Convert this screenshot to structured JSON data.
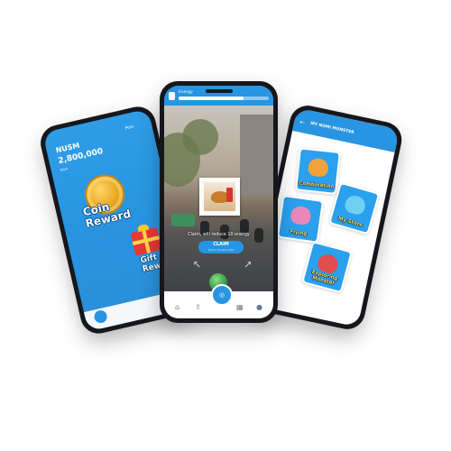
{
  "left_phone": {
    "brand": "NUSM",
    "coin_count": "2,800,000",
    "sub_label": "Koin",
    "points_label": "Poin",
    "coin_glyph": "Koin",
    "coin_reward_label_line1": "Coin",
    "coin_reward_label_line2": "Reward",
    "gift_reward_label_line1": "Gift",
    "gift_reward_label_line2": "Rewa"
  },
  "center_phone": {
    "energy_label": "Energy",
    "energy_level": 0.72,
    "hint_text": "Claim, will reduce 10 energy",
    "claim_label": "CLAIM",
    "claim_sub": "Period: Sunset 2019"
  },
  "right_phone": {
    "title": "MY NUMI MONSTER",
    "back_glyph": "←",
    "cards": [
      {
        "label": "Combination"
      },
      {
        "label": "My Store"
      },
      {
        "label": "Flying"
      },
      {
        "label": "Exploring Monster"
      }
    ]
  },
  "colors": {
    "brand_blue": "#2795e1",
    "gold": "#e9a21c",
    "gift_red": "#e53935"
  },
  "icons": [
    "coin-icon",
    "gift-icon",
    "home-icon",
    "upload-icon",
    "book-icon",
    "profile-icon",
    "scan-icon",
    "back-arrow-icon",
    "energy-icon",
    "globe-icon"
  ]
}
